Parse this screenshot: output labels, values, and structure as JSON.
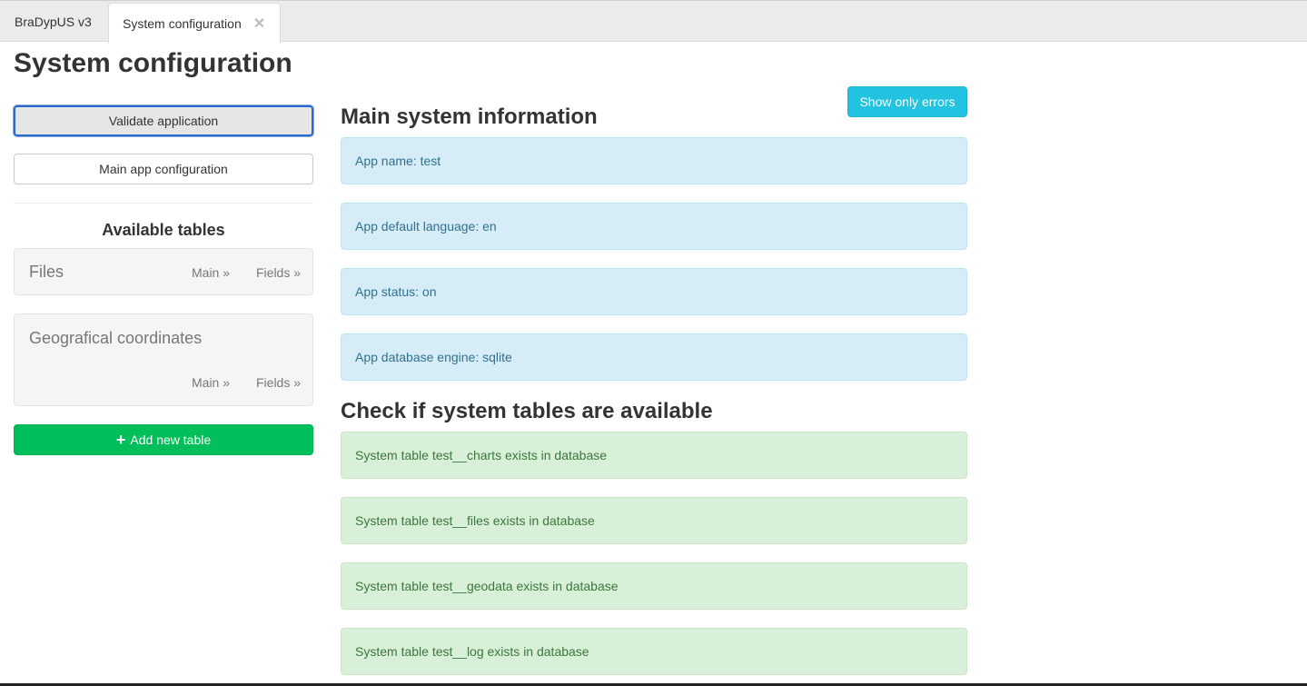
{
  "tabs": {
    "home_label": "BraDypUS v3",
    "active_label": "System configuration",
    "close_glyph": "✕"
  },
  "page_title": "System configuration",
  "sidebar": {
    "validate_label": "Validate application",
    "main_config_label": "Main app configuration",
    "available_tables_title": "Available tables",
    "tables": [
      {
        "name": "Files",
        "main_link": "Main »",
        "fields_link": "Fields »"
      },
      {
        "name": "Geografical coordinates",
        "main_link": "Main »",
        "fields_link": "Fields »"
      }
    ],
    "add_table_icon": "+",
    "add_table_label": "Add new table"
  },
  "main": {
    "show_errors_label": "Show only errors",
    "system_info_title": "Main system information",
    "system_info": [
      "App name: test",
      "App default language: en",
      "App status: on",
      "App database engine: sqlite"
    ],
    "system_tables_title": "Check if system tables are available",
    "system_tables": [
      "System table test__charts exists in database",
      "System table test__files exists in database",
      "System table test__geodata exists in database",
      "System table test__log exists in database"
    ]
  },
  "colors": {
    "success_button": "#00bf5a",
    "info_button": "#22c3e0",
    "info_alert_bg": "#d6edf7",
    "success_alert_bg": "#d8f0d7"
  }
}
